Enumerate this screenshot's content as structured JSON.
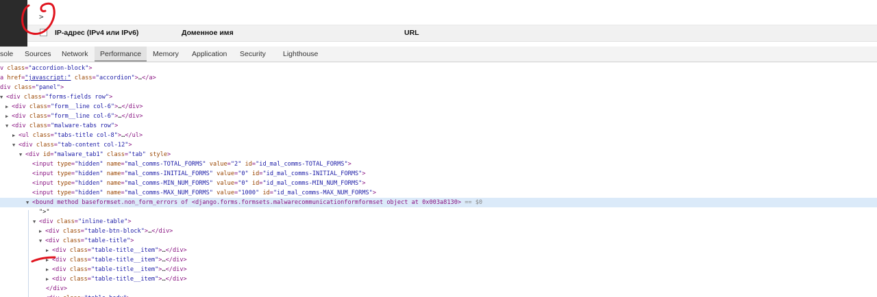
{
  "preview": {
    "gt": ">",
    "columns": {
      "ip": "IP-адрес (IPv4 или IPv6)",
      "domain": "Доменное имя",
      "url": "URL"
    }
  },
  "devtools": {
    "tabs": [
      "sole",
      "Sources",
      "Network",
      "Performance",
      "Memory",
      "Application",
      "Security",
      "Lighthouse"
    ],
    "active_tab": "Performance"
  },
  "dom_tree": [
    {
      "tri": "",
      "html": "<span class='tag'>v class=</span><span class='val'>\"accordion-block\"</span><span class='tag'>&gt;</span>"
    },
    {
      "tri": "",
      "html": "<span class='tag'>a </span><span class='attr'>href</span><span class='tag'>=</span><span class='link'>\"javascript:\"</span><span class='attr'> class</span><span class='tag'>=</span><span class='val'>\"accordion\"</span><span class='tag'>&gt;…&lt;/a&gt;</span>"
    }
  ],
  "annotation_color": "#e0141e"
}
